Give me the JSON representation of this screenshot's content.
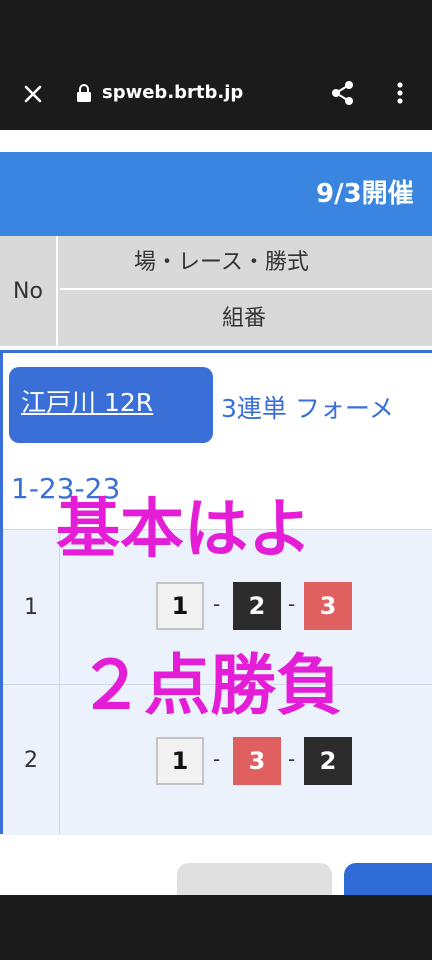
{
  "browser": {
    "url": "spweb.brtb.jp"
  },
  "page": {
    "date_header": "9/3開催",
    "table_header": {
      "no": "No",
      "race_columns": "場・レース・勝式",
      "combination": "組番"
    },
    "bet": {
      "venue_race": "江戸川 12R",
      "bet_type": "3連単 フォーメ",
      "combination_summary": "1-23-23"
    },
    "rows": [
      {
        "no": "1",
        "first": "1",
        "second": "2",
        "third": "3",
        "dash": "-"
      },
      {
        "no": "2",
        "first": "1",
        "second": "3",
        "third": "2",
        "dash": "-"
      }
    ]
  },
  "overlay_text": {
    "line1": "基本はよ",
    "line2": "２点勝負"
  },
  "colors": {
    "accent_blue": "#3a85e0",
    "badge_blue": "#3a6fd8",
    "overlay_magenta": "#e31ed6",
    "boat_1_white": "#f2f2f2",
    "boat_2_black": "#2c2c2c",
    "boat_3_red": "#e06060"
  }
}
